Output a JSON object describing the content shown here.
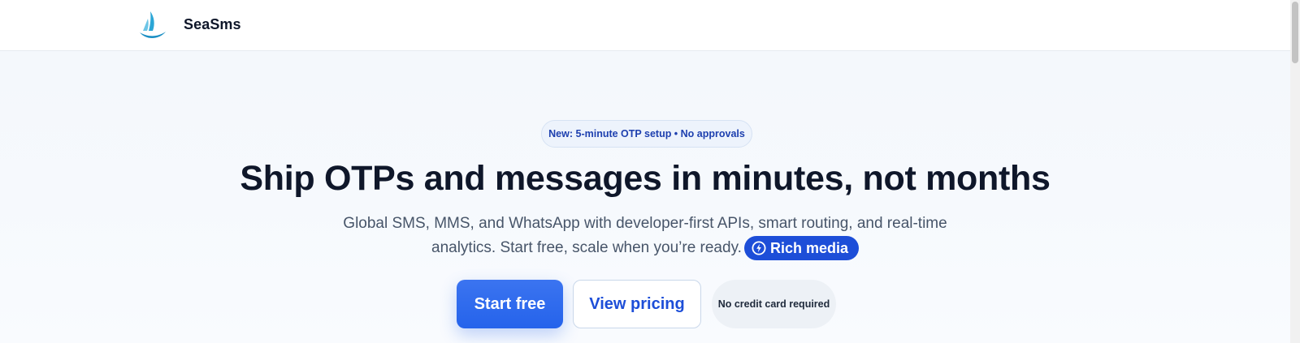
{
  "header": {
    "brand_name": "SeaSms",
    "logo_icon": "sailboat-icon"
  },
  "hero": {
    "badge": "New: 5-minute OTP setup • No approvals",
    "headline": "Ship OTPs and messages in minutes, not months",
    "subtitle_line1": "Global SMS, MMS, and WhatsApp with developer-first APIs, smart routing, and real-time",
    "subtitle_line2": "analytics. Start free, scale when you’re ready.",
    "pill": {
      "icon": "lightning-circle-icon",
      "label": "Rich media"
    },
    "cta": {
      "primary_label": "Start free",
      "secondary_label": "View pricing",
      "note": "No credit card required"
    }
  },
  "colors": {
    "accent": "#2563eb",
    "accent_dark": "#1d4ed8",
    "heading": "#0f172a",
    "body_text": "#475569"
  }
}
